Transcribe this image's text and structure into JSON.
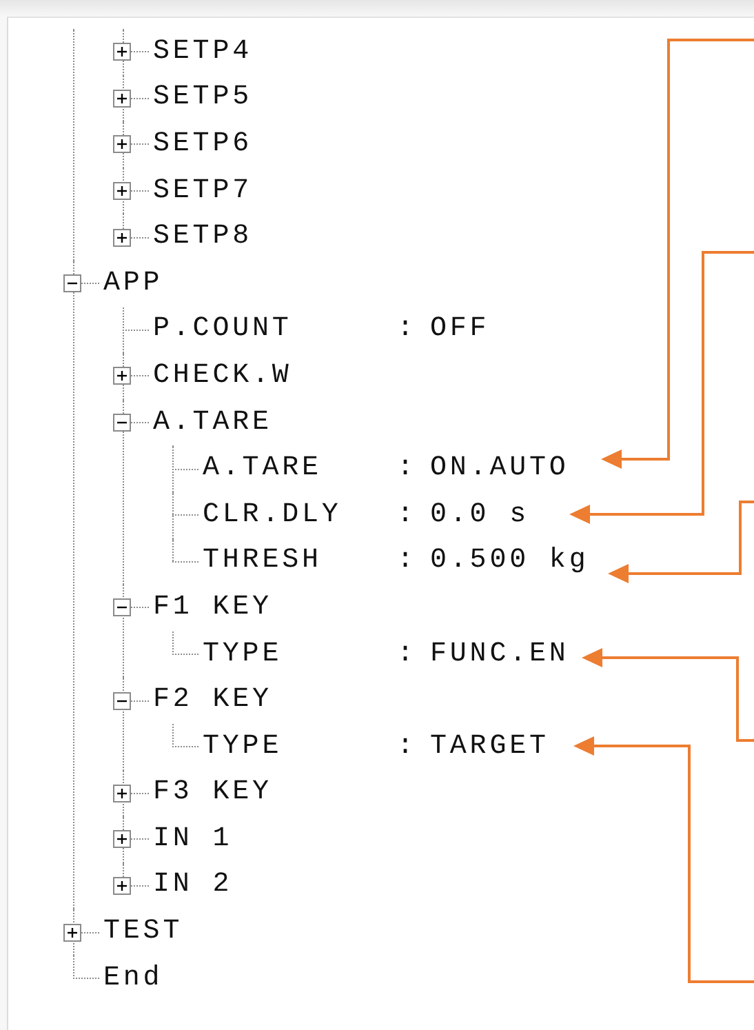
{
  "tree": [
    {
      "children": [
        {
          "kind": "branch",
          "label": "SETP4",
          "expanded": false
        },
        {
          "kind": "branch",
          "label": "SETP5",
          "expanded": false
        },
        {
          "kind": "branch",
          "label": "SETP6",
          "expanded": false
        },
        {
          "kind": "branch",
          "label": "SETP7",
          "expanded": false
        },
        {
          "kind": "branch",
          "label": "SETP8",
          "expanded": false
        }
      ]
    },
    {
      "kind": "branch",
      "label": "APP",
      "expanded": true,
      "children": [
        {
          "kind": "setting",
          "label": "P.COUNT",
          "separator": ":",
          "value": "OFF"
        },
        {
          "kind": "branch",
          "label": "CHECK.W",
          "expanded": false
        },
        {
          "kind": "branch",
          "label": "A.TARE",
          "expanded": true,
          "children": [
            {
              "kind": "setting",
              "label": "A.TARE",
              "separator": ":",
              "value": "ON.AUTO"
            },
            {
              "kind": "setting",
              "label": "CLR.DLY",
              "separator": ":",
              "value": "0.0 s"
            },
            {
              "kind": "setting",
              "label": "THRESH",
              "separator": ":",
              "value": "0.500 kg"
            }
          ]
        },
        {
          "kind": "branch",
          "label": "F1 KEY",
          "expanded": true,
          "children": [
            {
              "kind": "setting",
              "label": "TYPE",
              "separator": ":",
              "value": "FUNC.EN"
            }
          ]
        },
        {
          "kind": "branch",
          "label": "F2 KEY",
          "expanded": true,
          "children": [
            {
              "kind": "setting",
              "label": "TYPE",
              "separator": ":",
              "value": "TARGET"
            }
          ]
        },
        {
          "kind": "branch",
          "label": "F3 KEY",
          "expanded": false
        },
        {
          "kind": "branch",
          "label": "IN 1",
          "expanded": false
        },
        {
          "kind": "branch",
          "label": "IN 2",
          "expanded": false
        }
      ]
    },
    {
      "kind": "branch",
      "label": "TEST",
      "expanded": false
    },
    {
      "kind": "leaf",
      "label": "End"
    }
  ]
}
